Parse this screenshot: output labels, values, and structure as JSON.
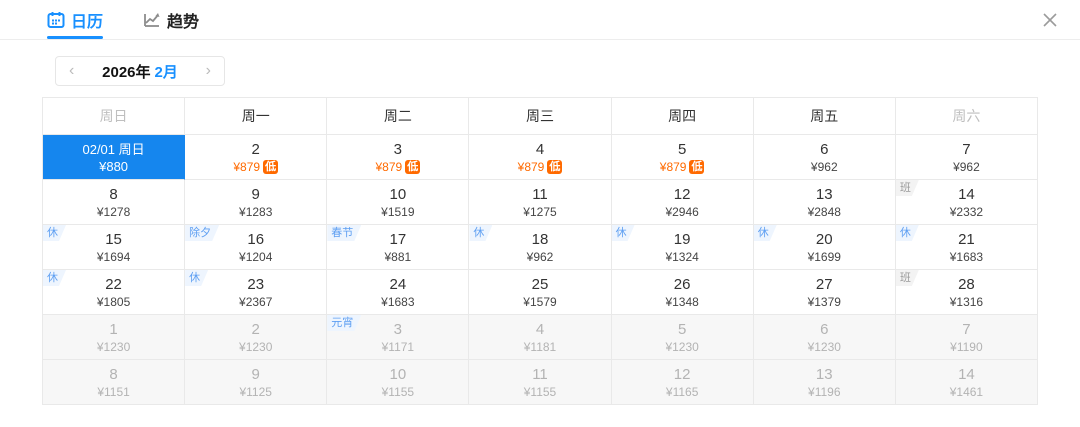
{
  "header": {
    "tabs": [
      {
        "label": "日历",
        "icon": "calendar-icon",
        "active": true
      },
      {
        "label": "趋势",
        "icon": "trend-icon",
        "active": false
      }
    ],
    "close_label": "✕"
  },
  "month_nav": {
    "prev": "‹",
    "year": "2026年",
    "month": "2月",
    "next": "›"
  },
  "weekdays": [
    {
      "label": "周日",
      "muted": true
    },
    {
      "label": "周一",
      "muted": false
    },
    {
      "label": "周二",
      "muted": false
    },
    {
      "label": "周三",
      "muted": false
    },
    {
      "label": "周四",
      "muted": false
    },
    {
      "label": "周五",
      "muted": false
    },
    {
      "label": "周六",
      "muted": true
    }
  ],
  "calendar": {
    "low_badge_label": "低",
    "rows": [
      [
        {
          "day": "02/01 周日",
          "price": "¥880",
          "selected": true
        },
        {
          "day": "2",
          "price": "¥879",
          "low": true
        },
        {
          "day": "3",
          "price": "¥879",
          "low": true
        },
        {
          "day": "4",
          "price": "¥879",
          "low": true
        },
        {
          "day": "5",
          "price": "¥879",
          "low": true
        },
        {
          "day": "6",
          "price": "¥962"
        },
        {
          "day": "7",
          "price": "¥962"
        }
      ],
      [
        {
          "day": "8",
          "price": "¥1278"
        },
        {
          "day": "9",
          "price": "¥1283"
        },
        {
          "day": "10",
          "price": "¥1519"
        },
        {
          "day": "11",
          "price": "¥1275"
        },
        {
          "day": "12",
          "price": "¥2946"
        },
        {
          "day": "13",
          "price": "¥2848"
        },
        {
          "day": "14",
          "price": "¥2332",
          "badge": "班",
          "badge_type": "work"
        }
      ],
      [
        {
          "day": "15",
          "price": "¥1694",
          "badge": "休",
          "badge_type": "rest"
        },
        {
          "day": "16",
          "price": "¥1204",
          "badge": "除夕",
          "badge_type": "festival"
        },
        {
          "day": "17",
          "price": "¥881",
          "badge": "春节",
          "badge_type": "festival"
        },
        {
          "day": "18",
          "price": "¥962",
          "badge": "休",
          "badge_type": "rest"
        },
        {
          "day": "19",
          "price": "¥1324",
          "badge": "休",
          "badge_type": "rest"
        },
        {
          "day": "20",
          "price": "¥1699",
          "badge": "休",
          "badge_type": "rest"
        },
        {
          "day": "21",
          "price": "¥1683",
          "badge": "休",
          "badge_type": "rest"
        }
      ],
      [
        {
          "day": "22",
          "price": "¥1805",
          "badge": "休",
          "badge_type": "rest"
        },
        {
          "day": "23",
          "price": "¥2367",
          "badge": "休",
          "badge_type": "rest"
        },
        {
          "day": "24",
          "price": "¥1683"
        },
        {
          "day": "25",
          "price": "¥1579"
        },
        {
          "day": "26",
          "price": "¥1348"
        },
        {
          "day": "27",
          "price": "¥1379"
        },
        {
          "day": "28",
          "price": "¥1316",
          "badge": "班",
          "badge_type": "work"
        }
      ],
      [
        {
          "day": "1",
          "price": "¥1230",
          "muted": true
        },
        {
          "day": "2",
          "price": "¥1230",
          "muted": true
        },
        {
          "day": "3",
          "price": "¥1171",
          "muted": true,
          "badge": "元宵",
          "badge_type": "festival"
        },
        {
          "day": "4",
          "price": "¥1181",
          "muted": true
        },
        {
          "day": "5",
          "price": "¥1230",
          "muted": true
        },
        {
          "day": "6",
          "price": "¥1230",
          "muted": true
        },
        {
          "day": "7",
          "price": "¥1190",
          "muted": true
        }
      ],
      [
        {
          "day": "8",
          "price": "¥1151",
          "muted": true
        },
        {
          "day": "9",
          "price": "¥1125",
          "muted": true
        },
        {
          "day": "10",
          "price": "¥1155",
          "muted": true
        },
        {
          "day": "11",
          "price": "¥1155",
          "muted": true
        },
        {
          "day": "12",
          "price": "¥1165",
          "muted": true
        },
        {
          "day": "13",
          "price": "¥1196",
          "muted": true
        },
        {
          "day": "14",
          "price": "¥1461",
          "muted": true
        }
      ]
    ]
  },
  "colors": {
    "accent": "#1890ff",
    "selected_bg": "#1586ee",
    "price_low_orange": "#ff6a00",
    "holiday_badge_text": "#5e9ff2",
    "holiday_badge_bg": "#eef5fe",
    "work_badge_text": "#9a9a9a",
    "muted_row_bg": "#f7f7f7"
  }
}
